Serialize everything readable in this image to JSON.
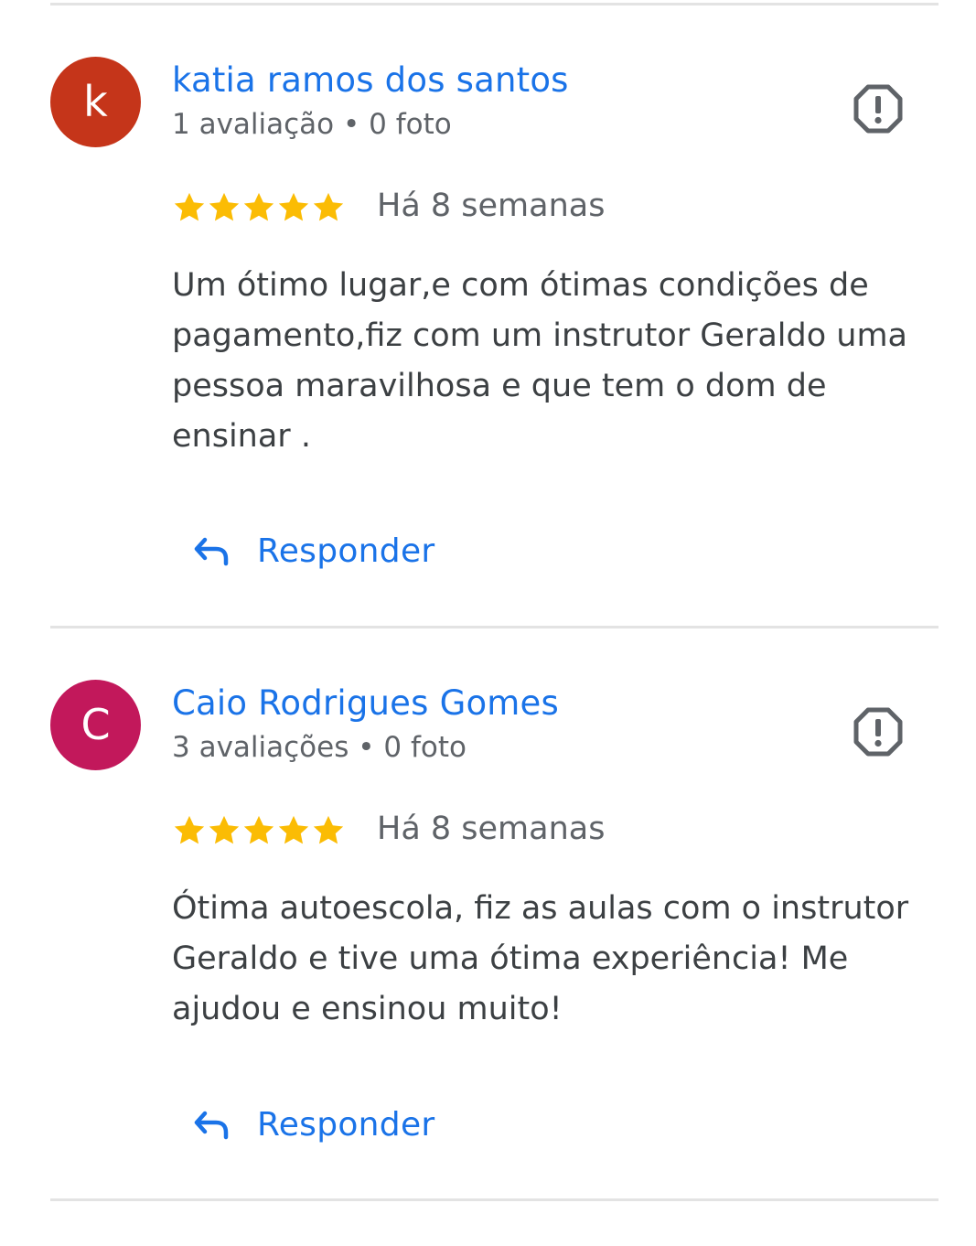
{
  "reviews": [
    {
      "avatar_letter": "k",
      "avatar_color": "#c5351a",
      "name": "katia ramos dos santos",
      "meta": "1 avaliação • 0 foto",
      "rating": 5,
      "time": "Há 8 semanas",
      "text": "Um ótimo lugar,e com ótimas condições de pagamento,fiz com um instrutor Geraldo uma pessoa maravilhosa e que tem o dom de ensinar .",
      "reply_label": "Responder"
    },
    {
      "avatar_letter": "C",
      "avatar_color": "#c2185b",
      "name": "Caio Rodrigues Gomes",
      "meta": "3 avaliações • 0 foto",
      "rating": 5,
      "time": "Há 8 semanas",
      "text": "Ótima autoescola, fiz as aulas com o instrutor Geraldo e tive uma ótima experiência! Me ajudou e ensinou muito!",
      "reply_label": "Responder"
    }
  ],
  "colors": {
    "link": "#1a73e8",
    "star": "#fbbc04",
    "secondary_text": "#5f6368",
    "body_text": "#3c4043",
    "divider": "#e3e3e3"
  },
  "icons": {
    "flag": "report-flag-icon",
    "star": "star-icon",
    "reply": "reply-arrow-icon"
  }
}
